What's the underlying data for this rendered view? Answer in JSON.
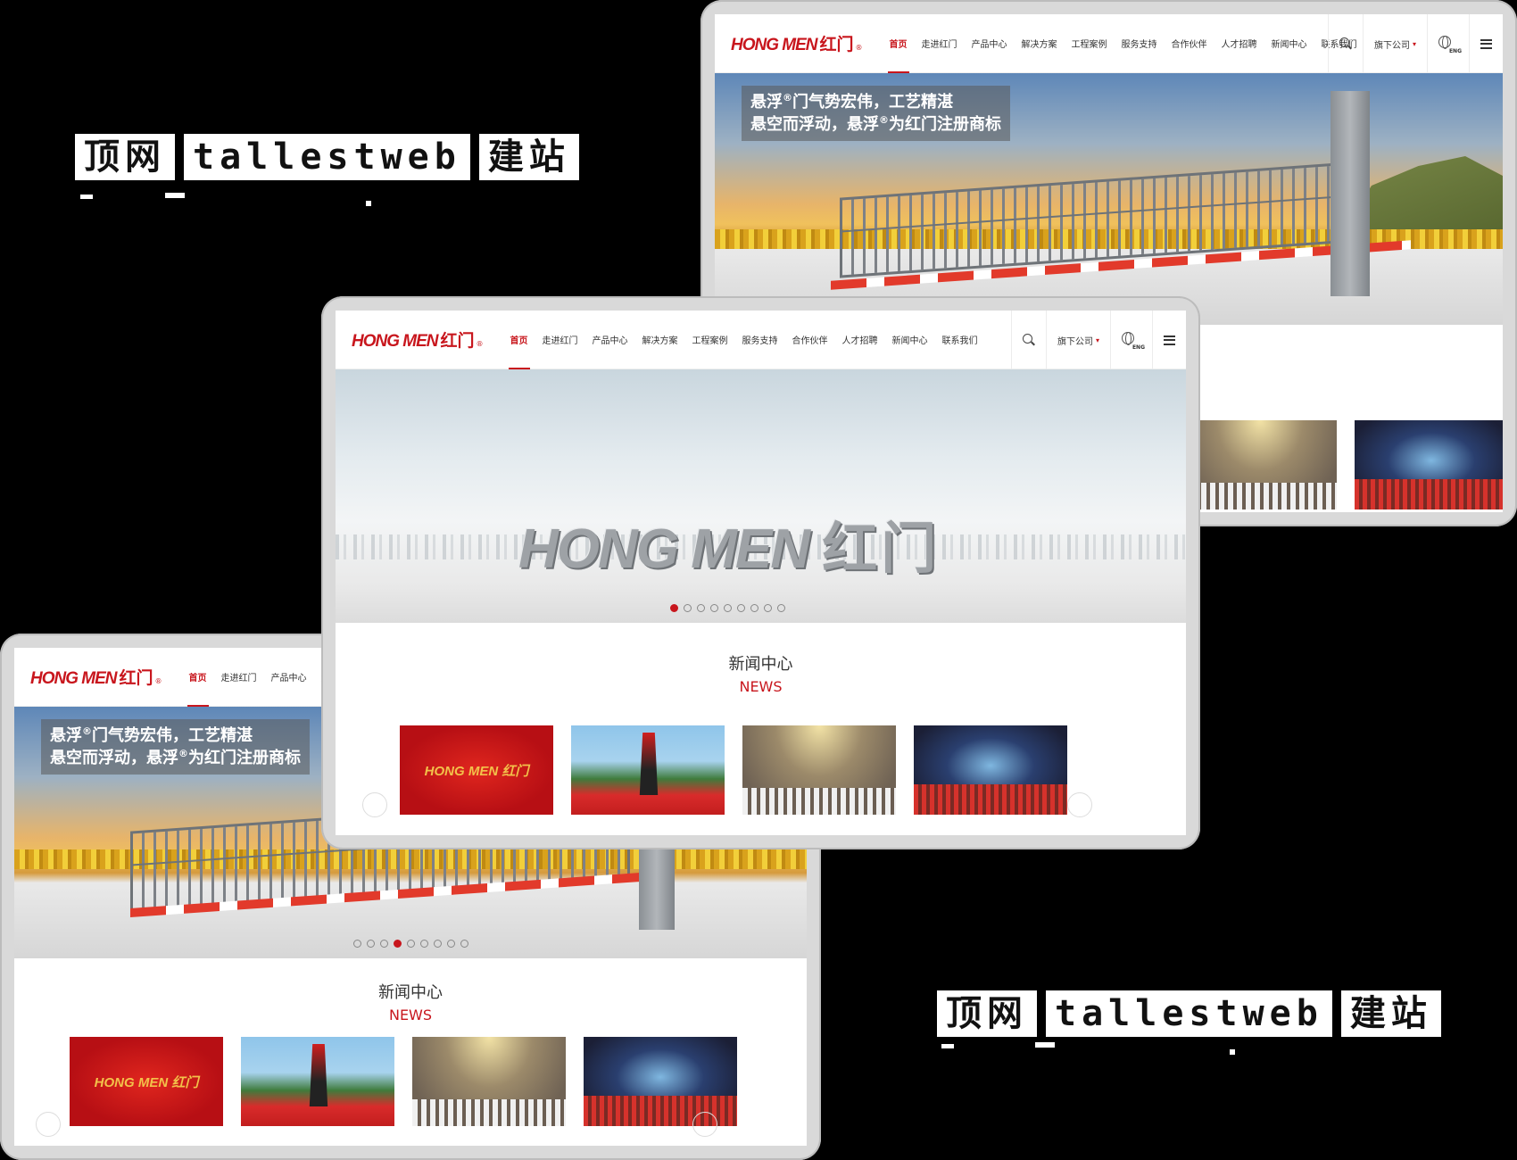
{
  "watermark": {
    "words": [
      "顶网",
      "tallestweb",
      "建站"
    ]
  },
  "site": {
    "logo_en": "HONG MEN",
    "logo_cn": "红门",
    "logo_reg": "®",
    "nav": [
      "首页",
      "走进红门",
      "产品中心",
      "解决方案",
      "工程案例",
      "服务支持",
      "合作伙伴",
      "人才招聘",
      "新闻中心",
      "联系我们"
    ],
    "active_nav": "首页",
    "subsidiary_label": "旗下公司",
    "lang_label": "ENG",
    "accent": "#c8161d"
  },
  "banner_sunset": {
    "line1_a": "悬浮",
    "line1_reg": "®",
    "line1_b": "门气势宏伟，工艺精湛",
    "line2_a": "悬空而浮动，悬浮",
    "line2_reg": "®",
    "line2_b": "为红门注册商标",
    "dot_count": 9,
    "active_dot": 4
  },
  "banner_logo": {
    "word": "HONG MEN",
    "word_cn": "红门",
    "dot_count": 9,
    "active_dot": 1
  },
  "news": {
    "title": "新闻中心",
    "subtitle": "NEWS",
    "thumb1_text": "HONG MEN 红门"
  }
}
